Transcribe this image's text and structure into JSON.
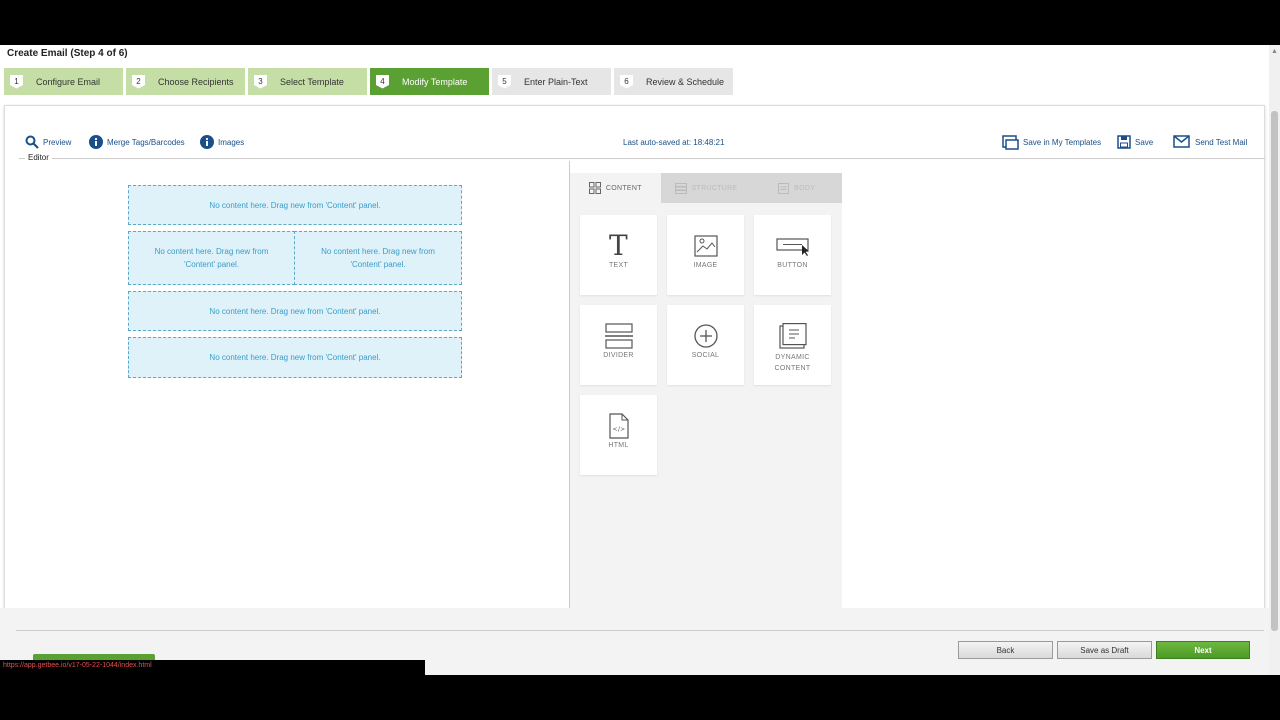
{
  "page": {
    "title": "Create Email (Step 4 of 6)"
  },
  "steps": [
    {
      "num": "1",
      "label": "Configure Email",
      "state": "done"
    },
    {
      "num": "2",
      "label": "Choose Recipients",
      "state": "done"
    },
    {
      "num": "3",
      "label": "Select Template",
      "state": "done"
    },
    {
      "num": "4",
      "label": "Modify Template",
      "state": "active"
    },
    {
      "num": "5",
      "label": "Enter Plain-Text",
      "state": "todo"
    },
    {
      "num": "6",
      "label": "Review & Schedule",
      "state": "todo"
    }
  ],
  "toolbar": {
    "preview": "Preview",
    "merge_tags": "Merge Tags/Barcodes",
    "images": "Images",
    "autosave": "Last auto-saved at: 18:48:21",
    "save_my_templates": "Save in My Templates",
    "save": "Save",
    "send_test": "Send Test Mail"
  },
  "editor": {
    "legend": "Editor",
    "empty_slot": "No content here. Drag new from 'Content' panel.",
    "empty_slot_left": "No content here. Drag new from 'Content' panel.",
    "empty_slot_right": "No content here. Drag new from 'Content' panel."
  },
  "side_panel": {
    "tabs": {
      "content": "CONTENT",
      "structure": "STRUCTURE",
      "body": "BODY"
    },
    "blocks": {
      "text": "TEXT",
      "image": "IMAGE",
      "button": "BUTTON",
      "divider": "DIVIDER",
      "social": "SOCIAL",
      "dynamic": "DYNAMIC CONTENT",
      "html": "HTML"
    }
  },
  "footer": {
    "back": "Back",
    "save_draft": "Save as Draft",
    "next": "Next",
    "status_url": "https://app.getbee.io/v17-05-22-1044/index.html"
  },
  "colors": {
    "accent": "#5aa032",
    "step_done": "#c5dea6",
    "link": "#1a4f8a",
    "slot_bg": "#dff2fa"
  }
}
